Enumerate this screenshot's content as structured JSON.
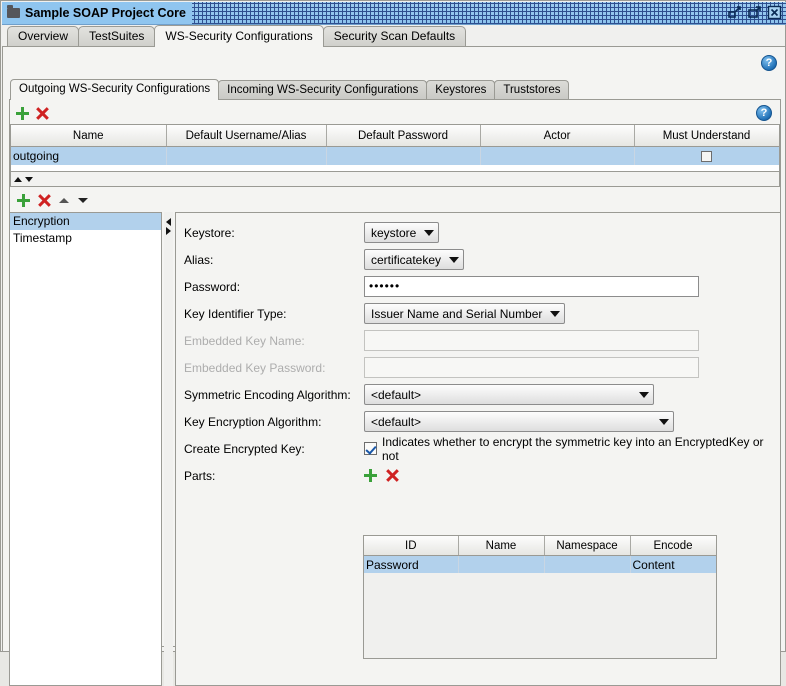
{
  "window": {
    "title": "Sample SOAP Project Core",
    "icon": "folder-icon",
    "buttons": [
      {
        "name": "minimize-button",
        "glyph": "minimize"
      },
      {
        "name": "maximize-button",
        "glyph": "maximize"
      },
      {
        "name": "close-button",
        "glyph": "close"
      }
    ]
  },
  "outer_tabs": [
    {
      "label": "Overview",
      "selected": false
    },
    {
      "label": "TestSuites",
      "selected": false
    },
    {
      "label": "WS-Security Configurations",
      "selected": true
    },
    {
      "label": "Security Scan Defaults",
      "selected": false
    }
  ],
  "help": {
    "glyph": "?",
    "name": "help-icon"
  },
  "inner_tabs": [
    {
      "label": "Outgoing WS-Security Configurations",
      "selected": true
    },
    {
      "label": "Incoming WS-Security Configurations",
      "selected": false
    },
    {
      "label": "Keystores",
      "selected": false
    },
    {
      "label": "Truststores",
      "selected": false
    }
  ],
  "config_toolbar": [
    {
      "name": "add-configuration-button",
      "icon": "plus-icon"
    },
    {
      "name": "remove-configuration-button",
      "icon": "x-icon"
    }
  ],
  "config_table": {
    "columns": [
      "Name",
      "Default Username/Alias",
      "Default Password",
      "Actor",
      "Must Understand"
    ],
    "rows": [
      {
        "selected": true,
        "name": "outgoing",
        "default_username": "",
        "default_password": "",
        "actor": "",
        "must_understand": false
      }
    ]
  },
  "sort_arrows": [
    {
      "name": "move-up-arrow",
      "icon": "triangle-up-icon"
    },
    {
      "name": "move-down-arrow",
      "icon": "triangle-down-icon"
    }
  ],
  "entry_toolbar": [
    {
      "name": "add-entry-button",
      "icon": "plus-icon"
    },
    {
      "name": "remove-entry-button",
      "icon": "x-icon"
    },
    {
      "name": "move-entry-up-button",
      "icon": "chevron-up-icon"
    },
    {
      "name": "move-entry-down-button",
      "icon": "chevron-down-icon"
    }
  ],
  "entry_list": [
    {
      "label": "Encryption",
      "selected": true
    },
    {
      "label": "Timestamp",
      "selected": false
    }
  ],
  "splitter": {
    "collapse_left": "chevron-left-icon",
    "collapse_right": "chevron-right-icon"
  },
  "form": {
    "keystore": {
      "label": "Keystore:",
      "value": "keystore",
      "disabled": false
    },
    "alias": {
      "label": "Alias:",
      "value": "certificatekey",
      "disabled": false
    },
    "password": {
      "label": "Password:",
      "value": "••••••",
      "disabled": false
    },
    "key_identifier_type": {
      "label": "Key Identifier Type:",
      "value": "Issuer Name and Serial Number",
      "disabled": false
    },
    "embedded_key_name": {
      "label": "Embedded Key Name:",
      "value": "",
      "disabled": true
    },
    "embedded_key_password": {
      "label": "Embedded Key Password:",
      "value": "",
      "disabled": true
    },
    "symmetric_encoding_algorithm": {
      "label": "Symmetric Encoding Algorithm:",
      "value": "<default>",
      "disabled": false
    },
    "key_encryption_algorithm": {
      "label": "Key Encryption Algorithm:",
      "value": "<default>",
      "disabled": false
    },
    "create_encrypted_key": {
      "label": "Create Encrypted Key:",
      "checked": true,
      "hint": "Indicates whether to encrypt the symmetric key into an EncryptedKey or not"
    },
    "parts": {
      "label": "Parts:"
    }
  },
  "parts_toolbar": [
    {
      "name": "add-part-button",
      "icon": "plus-icon"
    },
    {
      "name": "remove-part-button",
      "icon": "x-icon"
    }
  ],
  "parts_table": {
    "columns": [
      "ID",
      "Name",
      "Namespace",
      "Encode"
    ],
    "rows": [
      {
        "selected": true,
        "id": "Password",
        "name": "",
        "namespace": "",
        "encode": "Content"
      }
    ]
  },
  "colors": {
    "selection_blue": "#b2d1ec",
    "title_blue": "#8fc5ef",
    "accent_green": "#3aa13a",
    "accent_red": "#cf2222",
    "help_blue": "#1f6fb5"
  }
}
